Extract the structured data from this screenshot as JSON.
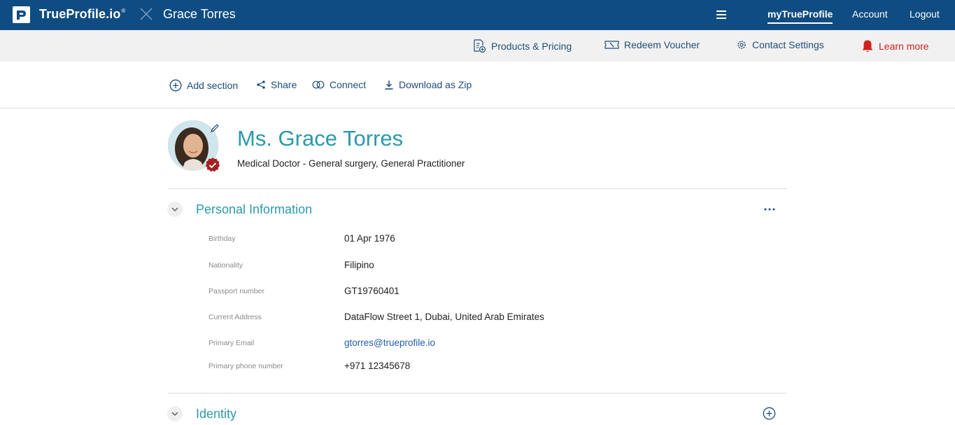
{
  "topbar": {
    "brand": "TrueProfile.io",
    "brand_mark": "®",
    "profile_name": "Grace Torres",
    "nav": {
      "my_profile": "myTrueProfile",
      "account": "Account",
      "logout": "Logout"
    }
  },
  "subbar": {
    "products_pricing": "Products & Pricing",
    "redeem_voucher": "Redeem Voucher",
    "contact_settings": "Contact Settings",
    "learn_more": "Learn more"
  },
  "actions": {
    "add_section": "Add section",
    "share": "Share",
    "connect": "Connect",
    "download_zip": "Download as Zip"
  },
  "profile": {
    "name": "Ms. Grace Torres",
    "title": "Medical Doctor - General surgery, General Practitioner"
  },
  "sections": {
    "personal_information": {
      "title": "Personal Information",
      "fields": [
        {
          "label": "Birthday",
          "value": "01 Apr 1976"
        },
        {
          "label": "Nationality",
          "value": "Filipino"
        },
        {
          "label": "Passport number",
          "value": "GT19760401"
        },
        {
          "label": "Current Address",
          "value": "DataFlow Street 1, Dubai, United Arab Emirates"
        },
        {
          "label": "Primary Email",
          "value": "gtorres@trueprofile.io"
        },
        {
          "label": "Primary phone number",
          "value": "+971 12345678"
        }
      ]
    },
    "identity": {
      "title": "Identity"
    }
  },
  "colors": {
    "topbar": "#0f4c81",
    "accent_teal": "#2a9aa8",
    "link_blue": "#1e4d78",
    "alert_red": "#d0201f"
  }
}
